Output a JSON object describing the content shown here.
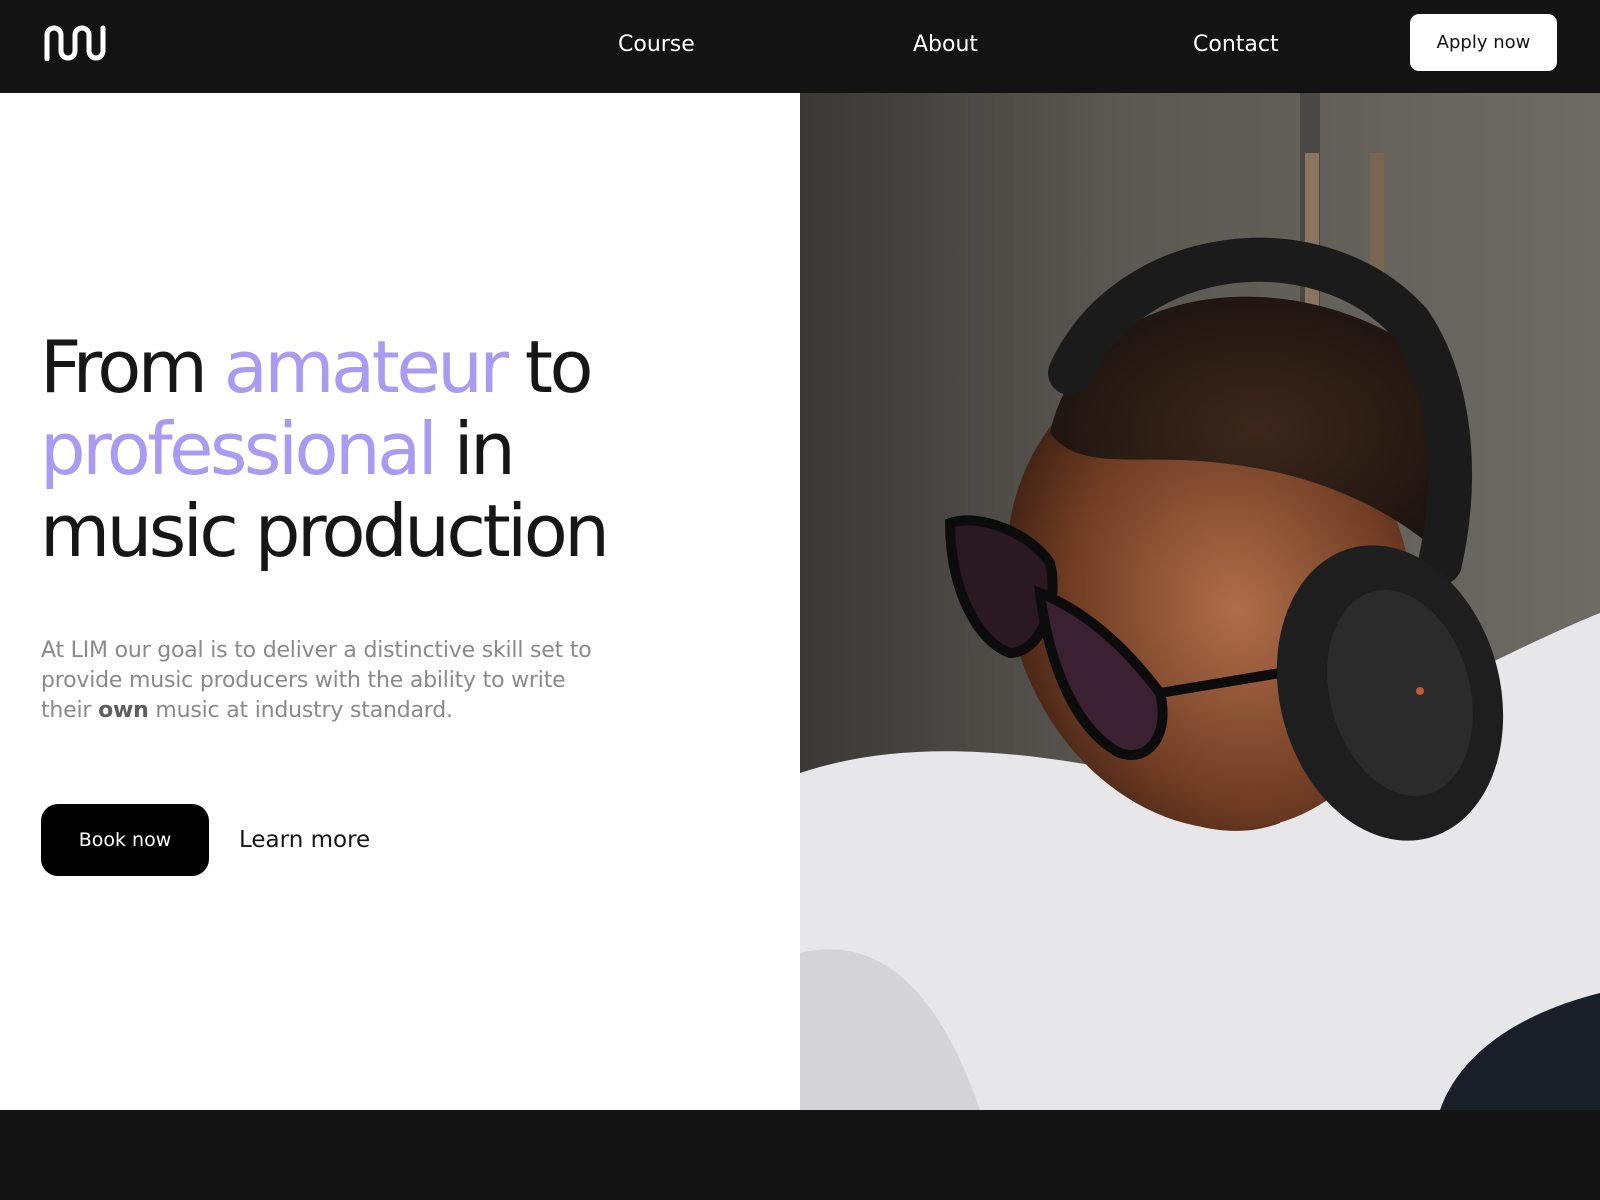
{
  "nav": {
    "logo": "logo-icon",
    "links": [
      "Course",
      "About",
      "Contact"
    ],
    "cta_label": "Apply now"
  },
  "hero": {
    "headline": {
      "line1_a": "From ",
      "line1_accent": "amateur",
      "line1_b": " to",
      "line2_accent": "professional",
      "line2_b": " in",
      "line3": "music production"
    },
    "description": {
      "part1": "At LIM our goal is to deliver a distinctive skill set to provide music producers with the ability to write their ",
      "emphasis": "own",
      "part2": " music at industry standard."
    },
    "primary_button": "Book now",
    "secondary_link": "Learn more",
    "image": "photo of a man wearing headphones and glasses looking down"
  },
  "colors": {
    "nav_bg": "#131313",
    "accent": "#a99bf2",
    "text": "#161616",
    "muted_text": "#8a8a8a",
    "button_bg": "#000000"
  }
}
